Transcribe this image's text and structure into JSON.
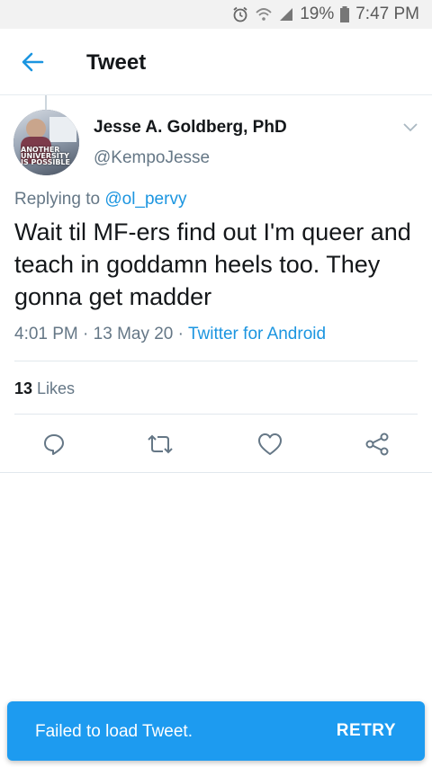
{
  "status_bar": {
    "battery_percent": "19%",
    "time": "7:47 PM",
    "icons": [
      "alarm-icon",
      "wifi-icon",
      "signal-icon",
      "battery-icon"
    ]
  },
  "app_bar": {
    "title": "Tweet",
    "back_icon": "arrow-left-icon"
  },
  "tweet": {
    "author_name": "Jesse A. Goldberg, PhD",
    "author_handle": "@KempoJesse",
    "avatar_text": "ANOTHER UNIVERSITY IS POSSIBLE",
    "reply_prefix": "Replying to ",
    "reply_mention": "@ol_pervy",
    "text": "Wait til MF-ers find out I'm queer and teach in goddamn heels too. They gonna get madder",
    "time": "4:01 PM",
    "dot1": " · ",
    "date": "13 May 20",
    "dot2": " · ",
    "source": "Twitter for Android",
    "likes_count": "13",
    "likes_label": " Likes"
  },
  "actions": [
    {
      "name": "reply",
      "icon": "reply-icon"
    },
    {
      "name": "retweet",
      "icon": "retweet-icon"
    },
    {
      "name": "like",
      "icon": "heart-icon"
    },
    {
      "name": "share",
      "icon": "share-icon"
    }
  ],
  "snackbar": {
    "message": "Failed to load Tweet.",
    "action": "RETRY"
  },
  "colors": {
    "accent": "#1b95e0",
    "snackbar_bg": "#1d9bf0",
    "secondary_text": "#657786",
    "primary_text": "#14171a"
  }
}
